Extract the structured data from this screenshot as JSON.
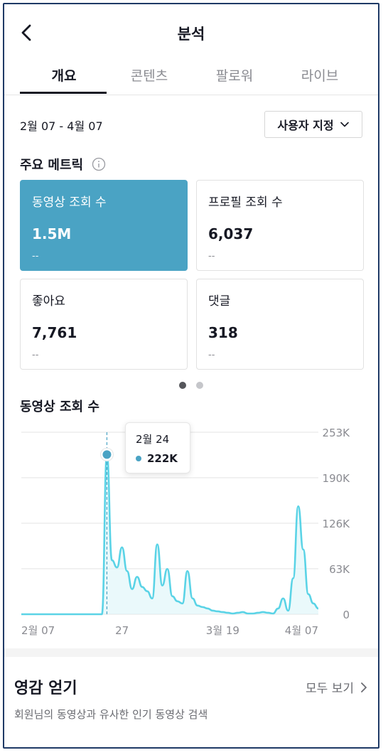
{
  "header": {
    "title": "분석",
    "back_icon": "chevron-left-icon"
  },
  "tabs": [
    {
      "label": "개요",
      "active": true
    },
    {
      "label": "콘텐츠",
      "active": false
    },
    {
      "label": "팔로워",
      "active": false
    },
    {
      "label": "라이브",
      "active": false
    }
  ],
  "date_range": "2월 07 - 4월 07",
  "custom_button": {
    "label": "사용자 지정",
    "icon": "chevron-down-icon"
  },
  "metrics_title": "주요 메트릭",
  "metrics": [
    {
      "label": "동영상 조회 수",
      "value": "1.5M",
      "delta": "--",
      "selected": true
    },
    {
      "label": "프로필 조회 수",
      "value": "6,037",
      "delta": "--",
      "selected": false
    },
    {
      "label": "좋아요",
      "value": "7,761",
      "delta": "--",
      "selected": false
    },
    {
      "label": "댓글",
      "value": "318",
      "delta": "--",
      "selected": false
    }
  ],
  "pager": {
    "pages": 2,
    "current": 1
  },
  "chart_title": "동영상 조회 수",
  "tooltip": {
    "date": "2월 24",
    "value": "222K"
  },
  "colors": {
    "accent": "#4aa3c4",
    "line": "#5ad3e6",
    "fill": "#d9f4f8"
  },
  "chart_data": {
    "type": "area",
    "ylim": [
      0,
      253000
    ],
    "y_ticks": [
      "253K",
      "190K",
      "126K",
      "63K",
      "0"
    ],
    "x_ticks": [
      "2월 07",
      "27",
      "3월 19",
      "4월 07"
    ],
    "x": [
      "2월 07",
      "2월 08",
      "2월 09",
      "2월 10",
      "2월 11",
      "2월 12",
      "2월 13",
      "2월 14",
      "2월 15",
      "2월 16",
      "2월 17",
      "2월 18",
      "2월 19",
      "2월 20",
      "2월 21",
      "2월 22",
      "2월 23",
      "2월 24",
      "2월 25",
      "2월 26",
      "2월 27",
      "2월 28",
      "3월 01",
      "3월 02",
      "3월 03",
      "3월 04",
      "3월 05",
      "3월 06",
      "3월 07",
      "3월 08",
      "3월 09",
      "3월 10",
      "3월 11",
      "3월 12",
      "3월 13",
      "3월 14",
      "3월 15",
      "3월 16",
      "3월 17",
      "3월 18",
      "3월 19",
      "3월 20",
      "3월 21",
      "3월 22",
      "3월 23",
      "3월 24",
      "3월 25",
      "3월 26",
      "3월 27",
      "3월 28",
      "3월 29",
      "3월 30",
      "3월 31",
      "4월 01",
      "4월 02",
      "4월 03",
      "4월 04",
      "4월 05",
      "4月 06",
      "4월 07"
    ],
    "series": [
      {
        "values": [
          0,
          0,
          0,
          0,
          0,
          0,
          0,
          0,
          0,
          0,
          0,
          0,
          0,
          0,
          0,
          0,
          0,
          222000,
          75000,
          65000,
          93000,
          60000,
          35000,
          52000,
          38000,
          32000,
          22000,
          97000,
          40000,
          63000,
          25000,
          18000,
          15000,
          60000,
          22000,
          12000,
          10000,
          8000,
          5000,
          4000,
          3000,
          2000,
          1000,
          2000,
          3000,
          1000,
          1000,
          2000,
          3000,
          2000,
          1000,
          8000,
          22000,
          5000,
          50000,
          150000,
          90000,
          28000,
          15000,
          8000
        ]
      }
    ]
  },
  "inspiration": {
    "title": "영감 얻기",
    "see_all": "모두 보기",
    "description": "회원님의 동영상과 유사한 인기 동영상 검색",
    "see_all_icon": "chevron-right-icon"
  }
}
